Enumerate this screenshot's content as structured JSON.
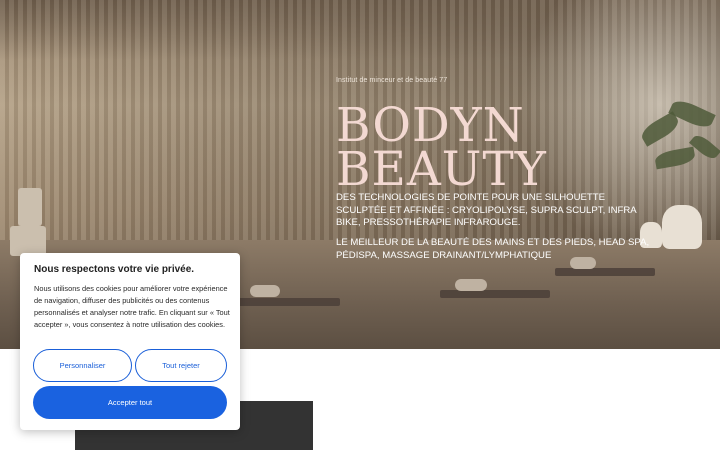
{
  "hero": {
    "eyebrow": "Institut de minceur et de beauté 77",
    "title_line1": "BODYN",
    "title_line2": "BEAUTY",
    "description1": "DES TECHNOLOGIES DE POINTE POUR UNE SILHOUETTE SCULPTÉE ET AFFINÉE : CRYOLIPOLYSE, SUPRA SCULPT, INFRA BIKE, PRESSOTHÉRAPIE INFRAROUGE.",
    "description2": "LE MEILLEUR DE LA BEAUTÉ DES MAINS ET DES PIEDS, HEAD SPA, PÉDISPA, MASSAGE DRAINANT/LYMPHATIQUE",
    "title_color": "#f3d9d2"
  },
  "cookie": {
    "title": "Nous respectons votre vie privée.",
    "body": "Nous utilisons des cookies pour améliorer votre expérience de navigation, diffuser des publicités ou des contenus personnalisés et analyser notre trafic. En cliquant sur « Tout accepter », vous consentez à notre utilisation des cookies.",
    "customize_label": "Personnaliser",
    "reject_label": "Tout rejeter",
    "accept_label": "Accepter tout",
    "accent_color": "#1a62e0"
  }
}
